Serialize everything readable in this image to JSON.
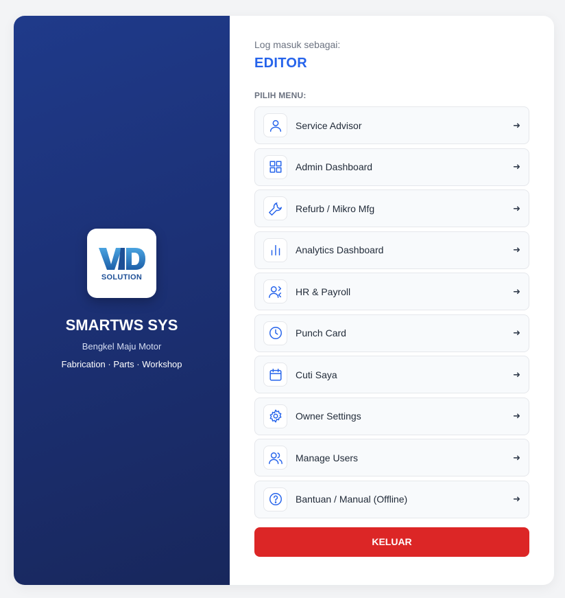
{
  "brand": {
    "logo_mark": "VD",
    "logo_word": "SOLUTION",
    "title": "SMARTWS SYS",
    "subtitle": "Bengkel Maju Motor",
    "tagline": "Fabrication · Parts · Workshop"
  },
  "session": {
    "login_label": "Log masuk sebagai:",
    "role": "EDITOR"
  },
  "menu": {
    "heading": "PILIH MENU:",
    "items": [
      {
        "label": "Service Advisor",
        "icon": "user-icon"
      },
      {
        "label": "Admin Dashboard",
        "icon": "grid-icon"
      },
      {
        "label": "Refurb / Mikro Mfg",
        "icon": "wrench-icon"
      },
      {
        "label": "Analytics Dashboard",
        "icon": "bar-chart-icon"
      },
      {
        "label": "HR & Payroll",
        "icon": "user-switch-icon"
      },
      {
        "label": "Punch Card",
        "icon": "clock-icon"
      },
      {
        "label": "Cuti Saya",
        "icon": "calendar-icon"
      },
      {
        "label": "Owner Settings",
        "icon": "gear-icon"
      },
      {
        "label": "Manage Users",
        "icon": "users-icon"
      },
      {
        "label": "Bantuan / Manual (Offline)",
        "icon": "help-circle-icon"
      }
    ],
    "arrow": "➜"
  },
  "logout": {
    "label": "KELUAR"
  },
  "colors": {
    "accent": "#2563eb",
    "danger": "#dc2626",
    "panel_dark": "#1c3176"
  }
}
